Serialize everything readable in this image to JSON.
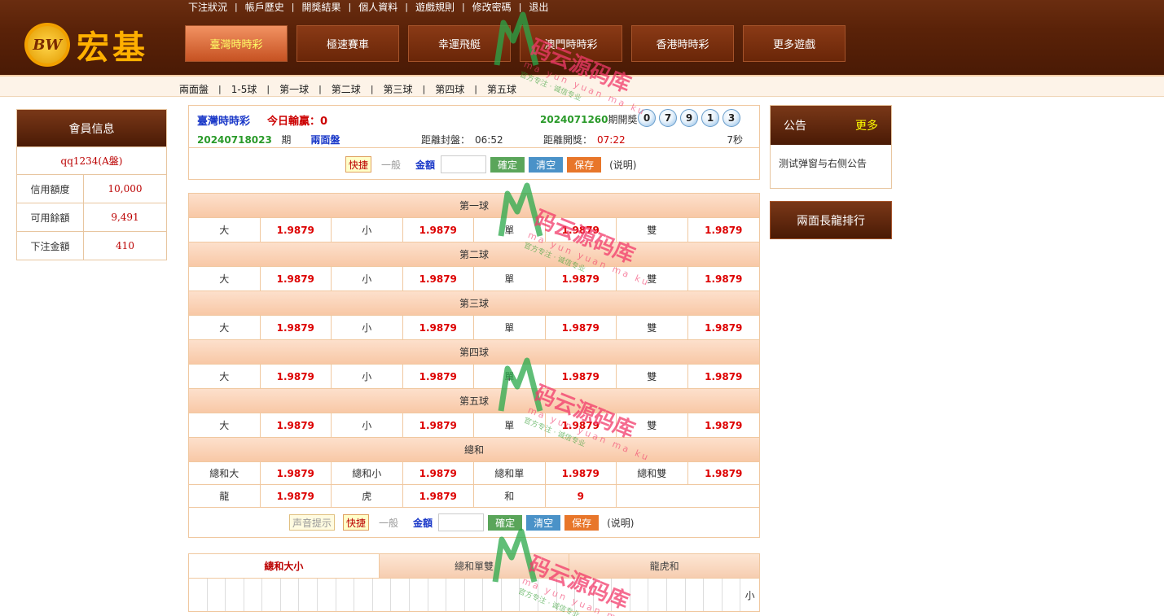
{
  "top_links": [
    "下注狀況",
    "帳戶歷史",
    "開獎結果",
    "個人資料",
    "遊戲規則",
    "修改密碼",
    "退出"
  ],
  "logo": {
    "badge": "BW",
    "text": "宏基"
  },
  "game_tabs": [
    "臺灣時時彩",
    "極速賽車",
    "幸運飛艇",
    "澳門時時彩",
    "香港時時彩",
    "更多遊戲"
  ],
  "sub_nav": [
    "兩面盤",
    "1-5球",
    "第一球",
    "第二球",
    "第三球",
    "第四球",
    "第五球"
  ],
  "member": {
    "title": "會員信息",
    "username": "qq1234(A盤)",
    "rows": [
      {
        "label": "信用額度",
        "value": "10,000"
      },
      {
        "label": "可用餘額",
        "value": "9,491"
      },
      {
        "label": "下注金額",
        "value": "410"
      }
    ]
  },
  "info": {
    "lottery_name": "臺灣時時彩",
    "today_label": "今日輸贏：0",
    "prev_issue_number": "2024071260",
    "prev_issue_label": "期開獎：",
    "balls": [
      "0",
      "7",
      "9",
      "1",
      "3"
    ],
    "cur_issue_number": "20240718023",
    "cur_issue_suffix": "期",
    "mode": "兩面盤",
    "close_label": "距離封盤：",
    "close_value": "06:52",
    "draw_label": "距離開獎：",
    "draw_value": "07:22",
    "seconds": "7秒"
  },
  "controls": {
    "quick": "快捷",
    "normal": "一般",
    "amount_label": "金額",
    "confirm": "確定",
    "clear": "清空",
    "save": "保存",
    "help": "(说明)",
    "sound": "声音提示"
  },
  "sections": [
    {
      "title": "第一球",
      "rows": [
        [
          {
            "l": "大",
            "o": "1.9879"
          },
          {
            "l": "小",
            "o": "1.9879"
          },
          {
            "l": "單",
            "o": "1.9879"
          },
          {
            "l": "雙",
            "o": "1.9879"
          }
        ]
      ]
    },
    {
      "title": "第二球",
      "rows": [
        [
          {
            "l": "大",
            "o": "1.9879"
          },
          {
            "l": "小",
            "o": "1.9879"
          },
          {
            "l": "單",
            "o": "1.9879"
          },
          {
            "l": "雙",
            "o": "1.9879"
          }
        ]
      ]
    },
    {
      "title": "第三球",
      "rows": [
        [
          {
            "l": "大",
            "o": "1.9879"
          },
          {
            "l": "小",
            "o": "1.9879"
          },
          {
            "l": "單",
            "o": "1.9879"
          },
          {
            "l": "雙",
            "o": "1.9879"
          }
        ]
      ]
    },
    {
      "title": "第四球",
      "rows": [
        [
          {
            "l": "大",
            "o": "1.9879"
          },
          {
            "l": "小",
            "o": "1.9879"
          },
          {
            "l": "單",
            "o": "1.9879"
          },
          {
            "l": "雙",
            "o": "1.9879"
          }
        ]
      ]
    },
    {
      "title": "第五球",
      "rows": [
        [
          {
            "l": "大",
            "o": "1.9879"
          },
          {
            "l": "小",
            "o": "1.9879"
          },
          {
            "l": "單",
            "o": "1.9879"
          },
          {
            "l": "雙",
            "o": "1.9879"
          }
        ]
      ]
    },
    {
      "title": "總和",
      "rows": [
        [
          {
            "l": "總和大",
            "o": "1.9879"
          },
          {
            "l": "總和小",
            "o": "1.9879"
          },
          {
            "l": "總和單",
            "o": "1.9879"
          },
          {
            "l": "總和雙",
            "o": "1.9879"
          }
        ],
        [
          {
            "l": "龍",
            "o": "1.9879"
          },
          {
            "l": "虎",
            "o": "1.9879"
          },
          {
            "l": "和",
            "o": "9"
          }
        ]
      ]
    }
  ],
  "road_tabs": [
    "總和大小",
    "總和單雙",
    "龍虎和"
  ],
  "road_last_value": "小",
  "notice": {
    "title": "公告",
    "more": "更多",
    "body": "测试弹窗与右侧公告"
  },
  "dragon_rank": "兩面長龍排行",
  "watermark": {
    "text": "码云源码库",
    "pinyin": "ma yun yuan ma ku",
    "slogan": "官方专注 · 诚信专业"
  },
  "colors": {
    "header_brown": "#5a2208",
    "active_tab": "#e0723e",
    "odds_red": "#dd0000",
    "accent_blue": "#1a38c8",
    "accent_green": "#2a9a2a"
  }
}
